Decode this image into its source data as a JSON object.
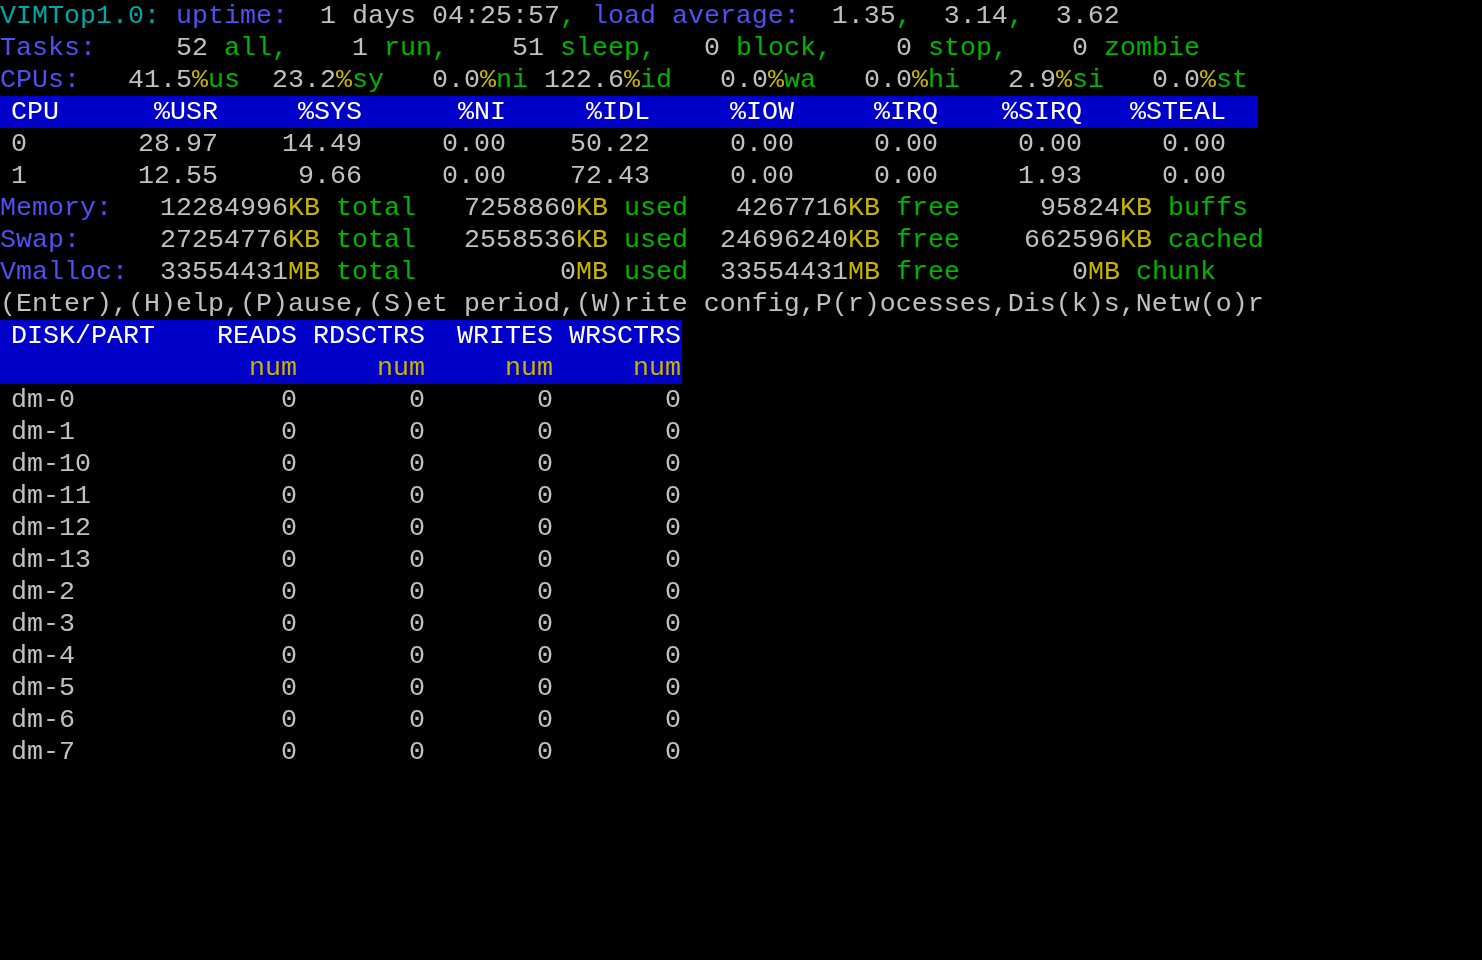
{
  "summary_lines": [
    [
      {
        "text": "VIMTop1.0:",
        "kind": "title"
      },
      {
        "text": " uptime:",
        "kind": "label"
      },
      {
        "text": "  1 days 04:25:57",
        "kind": "value"
      },
      {
        "text": ",",
        "kind": "keyword"
      },
      {
        "text": " load average:",
        "kind": "label"
      },
      {
        "text": "  1.35",
        "kind": "value"
      },
      {
        "text": ",",
        "kind": "keyword"
      },
      {
        "text": "  3.14",
        "kind": "value"
      },
      {
        "text": ",",
        "kind": "keyword"
      },
      {
        "text": "  3.62",
        "kind": "value"
      }
    ],
    [
      {
        "text": "Tasks:",
        "kind": "label"
      },
      {
        "text": "     52",
        "kind": "value"
      },
      {
        "text": " all,",
        "kind": "keyword"
      },
      {
        "text": "    1",
        "kind": "value"
      },
      {
        "text": " run,",
        "kind": "keyword"
      },
      {
        "text": "    51",
        "kind": "value"
      },
      {
        "text": " sleep,",
        "kind": "keyword"
      },
      {
        "text": "   0",
        "kind": "value"
      },
      {
        "text": " block,",
        "kind": "keyword"
      },
      {
        "text": "    0",
        "kind": "value"
      },
      {
        "text": " stop,",
        "kind": "keyword"
      },
      {
        "text": "    0",
        "kind": "value"
      },
      {
        "text": " zombie",
        "kind": "keyword"
      }
    ],
    [
      {
        "text": "CPUs:",
        "kind": "label"
      },
      {
        "text": "   41.5",
        "kind": "value"
      },
      {
        "text": "%",
        "kind": "unit"
      },
      {
        "text": "us",
        "kind": "keyword"
      },
      {
        "text": "  23.2",
        "kind": "value"
      },
      {
        "text": "%",
        "kind": "unit"
      },
      {
        "text": "sy",
        "kind": "keyword"
      },
      {
        "text": "   0.0",
        "kind": "value"
      },
      {
        "text": "%",
        "kind": "unit"
      },
      {
        "text": "ni",
        "kind": "keyword"
      },
      {
        "text": " 122.6",
        "kind": "value"
      },
      {
        "text": "%",
        "kind": "unit"
      },
      {
        "text": "id",
        "kind": "keyword"
      },
      {
        "text": "   0.0",
        "kind": "value"
      },
      {
        "text": "%",
        "kind": "unit"
      },
      {
        "text": "wa",
        "kind": "keyword"
      },
      {
        "text": "   0.0",
        "kind": "value"
      },
      {
        "text": "%",
        "kind": "unit"
      },
      {
        "text": "hi",
        "kind": "keyword"
      },
      {
        "text": "   2.9",
        "kind": "value"
      },
      {
        "text": "%",
        "kind": "unit"
      },
      {
        "text": "si",
        "kind": "keyword"
      },
      {
        "text": "   0.0",
        "kind": "value"
      },
      {
        "text": "%",
        "kind": "unit"
      },
      {
        "text": "st",
        "kind": "keyword"
      }
    ]
  ],
  "cpu_table": {
    "columns": [
      "CPU",
      "%USR",
      "%SYS",
      "%NI",
      "%IDL",
      "%IOW",
      "%IRQ",
      "%SIRQ",
      "%STEAL"
    ],
    "rows": [
      [
        "0",
        "28.97",
        "14.49",
        "0.00",
        "50.22",
        "0.00",
        "0.00",
        "0.00",
        "0.00"
      ],
      [
        "1",
        "12.55",
        "9.66",
        "0.00",
        "72.43",
        "0.00",
        "0.00",
        "1.93",
        "0.00"
      ]
    ]
  },
  "memory_lines": [
    [
      {
        "text": "Memory:",
        "kind": "label"
      },
      {
        "text": "   12284996",
        "kind": "value"
      },
      {
        "text": "KB",
        "kind": "unit"
      },
      {
        "text": " total",
        "kind": "keyword"
      },
      {
        "text": "   7258860",
        "kind": "value"
      },
      {
        "text": "KB",
        "kind": "unit"
      },
      {
        "text": " used",
        "kind": "keyword"
      },
      {
        "text": "   4267716",
        "kind": "value"
      },
      {
        "text": "KB",
        "kind": "unit"
      },
      {
        "text": " free",
        "kind": "keyword"
      },
      {
        "text": "     95824",
        "kind": "value"
      },
      {
        "text": "KB",
        "kind": "unit"
      },
      {
        "text": " buffs",
        "kind": "keyword"
      }
    ],
    [
      {
        "text": "Swap:",
        "kind": "label"
      },
      {
        "text": "     27254776",
        "kind": "value"
      },
      {
        "text": "KB",
        "kind": "unit"
      },
      {
        "text": " total",
        "kind": "keyword"
      },
      {
        "text": "   2558536",
        "kind": "value"
      },
      {
        "text": "KB",
        "kind": "unit"
      },
      {
        "text": " used",
        "kind": "keyword"
      },
      {
        "text": "  24696240",
        "kind": "value"
      },
      {
        "text": "KB",
        "kind": "unit"
      },
      {
        "text": " free",
        "kind": "keyword"
      },
      {
        "text": "    662596",
        "kind": "value"
      },
      {
        "text": "KB",
        "kind": "unit"
      },
      {
        "text": " cached",
        "kind": "keyword"
      }
    ],
    [
      {
        "text": "Vmalloc:",
        "kind": "label"
      },
      {
        "text": "  33554431",
        "kind": "value"
      },
      {
        "text": "MB",
        "kind": "unit"
      },
      {
        "text": " total",
        "kind": "keyword"
      },
      {
        "text": "         0",
        "kind": "value"
      },
      {
        "text": "MB",
        "kind": "unit"
      },
      {
        "text": " used",
        "kind": "keyword"
      },
      {
        "text": "  33554431",
        "kind": "value"
      },
      {
        "text": "MB",
        "kind": "unit"
      },
      {
        "text": " free",
        "kind": "keyword"
      },
      {
        "text": "       0",
        "kind": "value"
      },
      {
        "text": "MB",
        "kind": "unit"
      },
      {
        "text": " chunk",
        "kind": "keyword"
      }
    ]
  ],
  "help_line": "(Enter),(H)elp,(P)ause,(S)et period,(W)rite config,P(r)ocesses,Dis(k)s,Netw(o)r",
  "disk_table": {
    "columns": [
      "DISK/PART",
      "READS",
      "RDSCTRS",
      "WRITES",
      "WRSCTRS"
    ],
    "units": [
      "num",
      "num",
      "num",
      "num"
    ],
    "rows": [
      [
        "dm-0",
        "0",
        "0",
        "0",
        "0"
      ],
      [
        "dm-1",
        "0",
        "0",
        "0",
        "0"
      ],
      [
        "dm-10",
        "0",
        "0",
        "0",
        "0"
      ],
      [
        "dm-11",
        "0",
        "0",
        "0",
        "0"
      ],
      [
        "dm-12",
        "0",
        "0",
        "0",
        "0"
      ],
      [
        "dm-13",
        "0",
        "0",
        "0",
        "0"
      ],
      [
        "dm-2",
        "0",
        "0",
        "0",
        "0"
      ],
      [
        "dm-3",
        "0",
        "0",
        "0",
        "0"
      ],
      [
        "dm-4",
        "0",
        "0",
        "0",
        "0"
      ],
      [
        "dm-5",
        "0",
        "0",
        "0",
        "0"
      ],
      [
        "dm-6",
        "0",
        "0",
        "0",
        "0"
      ],
      [
        "dm-7",
        "0",
        "0",
        "0",
        "0"
      ]
    ]
  }
}
